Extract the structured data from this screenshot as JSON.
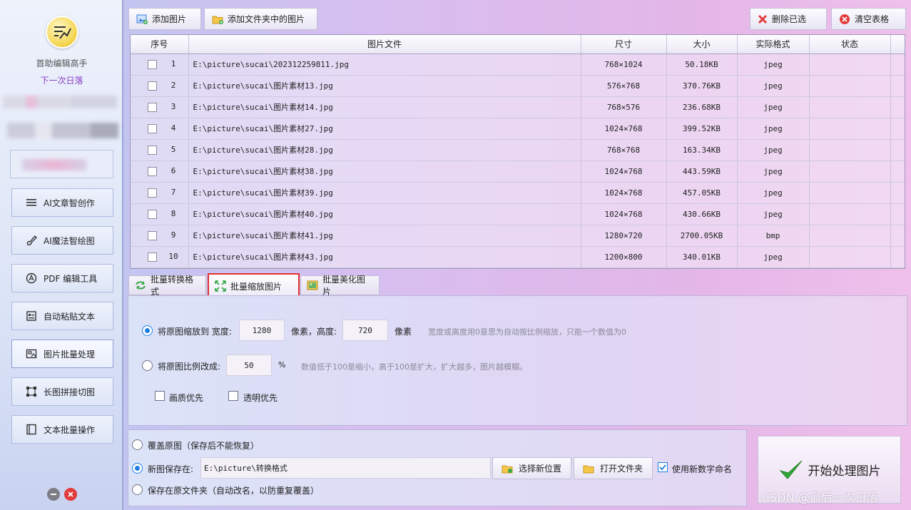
{
  "sidebar": {
    "app_name": "首助编辑高手",
    "app_sub": "下一次日落",
    "items": [
      {
        "label": "AI文章智创作",
        "icon": "list-icon"
      },
      {
        "label": "AI魔法智绘图",
        "icon": "brush-icon"
      },
      {
        "label": "PDF 编辑工具",
        "icon": "pdf-icon"
      },
      {
        "label": "自动粘贴文本",
        "icon": "clipboard-icon"
      },
      {
        "label": "图片批量处理",
        "icon": "image-icon"
      },
      {
        "label": "长图拼接切图",
        "icon": "crop-icon"
      },
      {
        "label": "文本批量操作",
        "icon": "document-icon"
      }
    ]
  },
  "toolbar": {
    "add_image": "添加图片",
    "add_folder": "添加文件夹中的图片",
    "delete_selected": "删除已选",
    "clear_table": "清空表格"
  },
  "table": {
    "headers": [
      "序号",
      "图片文件",
      "尺寸",
      "大小",
      "实际格式",
      "状态"
    ],
    "rows": [
      {
        "no": "1",
        "file": "E:\\picture\\sucai\\202312259811.jpg",
        "size": "768×1024",
        "bytes": "50.18KB",
        "format": "jpeg",
        "status": ""
      },
      {
        "no": "2",
        "file": "E:\\picture\\sucai\\图片素材13.jpg",
        "size": "576×768",
        "bytes": "370.76KB",
        "format": "jpeg",
        "status": ""
      },
      {
        "no": "3",
        "file": "E:\\picture\\sucai\\图片素材14.jpg",
        "size": "768×576",
        "bytes": "236.68KB",
        "format": "jpeg",
        "status": ""
      },
      {
        "no": "4",
        "file": "E:\\picture\\sucai\\图片素材27.jpg",
        "size": "1024×768",
        "bytes": "399.52KB",
        "format": "jpeg",
        "status": ""
      },
      {
        "no": "5",
        "file": "E:\\picture\\sucai\\图片素材28.jpg",
        "size": "768×768",
        "bytes": "163.34KB",
        "format": "jpeg",
        "status": ""
      },
      {
        "no": "6",
        "file": "E:\\picture\\sucai\\图片素材38.jpg",
        "size": "1024×768",
        "bytes": "443.59KB",
        "format": "jpeg",
        "status": ""
      },
      {
        "no": "7",
        "file": "E:\\picture\\sucai\\图片素材39.jpg",
        "size": "1024×768",
        "bytes": "457.05KB",
        "format": "jpeg",
        "status": ""
      },
      {
        "no": "8",
        "file": "E:\\picture\\sucai\\图片素材40.jpg",
        "size": "1024×768",
        "bytes": "430.66KB",
        "format": "jpeg",
        "status": ""
      },
      {
        "no": "9",
        "file": "E:\\picture\\sucai\\图片素材41.jpg",
        "size": "1280×720",
        "bytes": "2700.05KB",
        "format": "bmp",
        "status": ""
      },
      {
        "no": "10",
        "file": "E:\\picture\\sucai\\图片素材43.jpg",
        "size": "1200×800",
        "bytes": "340.01KB",
        "format": "jpeg",
        "status": ""
      }
    ]
  },
  "tabs": {
    "convert": "批量转换格式",
    "resize": "批量缩放图片",
    "beautify": "批量美化图片"
  },
  "resize": {
    "mode1_label": "将原图缩放到 宽度:",
    "width": "1280",
    "px_height_label": "像素，高度:",
    "height": "720",
    "px_label": "像素",
    "mode1_hint": "宽度或高度用0意思为自动按比例缩放，只能一个数值为0",
    "mode2_label": "将原图比例改成:",
    "percent": "50",
    "percent_unit": "%",
    "mode2_hint": "数值低于100是缩小，高于100是扩大，扩大越多，图片越模糊。",
    "quality_first": "画质优先",
    "transparency_first": "透明优先"
  },
  "output": {
    "overwrite": "覆盖原图（保存后不能恢复）",
    "save_new_label": "新图保存在:",
    "save_path": "E:\\picture\\转换格式",
    "choose_location": "选择新位置",
    "open_folder": "打开文件夹",
    "use_number_name": "使用新数字命名",
    "save_in_original": "保存在原文件夹（自动改名，以防重复覆盖）"
  },
  "start_button": "开始处理图片",
  "watermark": "CSDN @最后一次日落",
  "colors": {
    "accent": "#1e7ee0",
    "highlight_border": "#e03232",
    "delete_red": "#e23b3b"
  }
}
